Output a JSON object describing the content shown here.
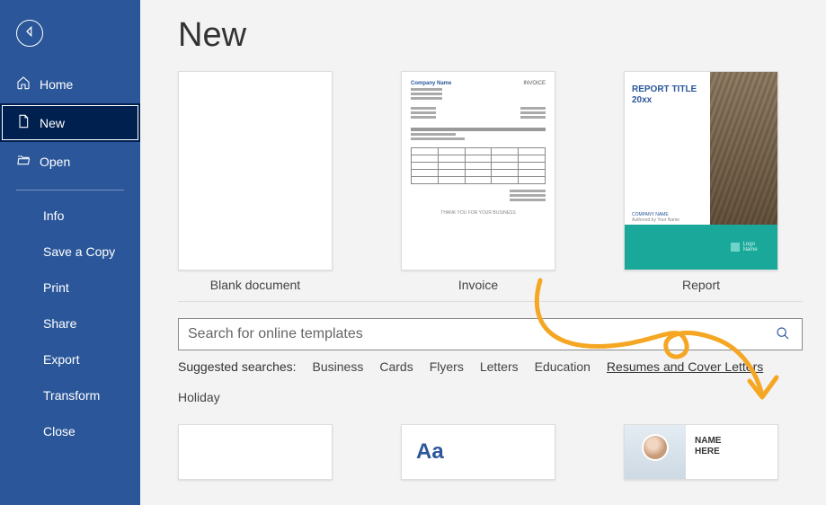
{
  "sidebar": {
    "nav": [
      {
        "label": "Home",
        "icon": "home"
      },
      {
        "label": "New",
        "icon": "file",
        "selected": true
      },
      {
        "label": "Open",
        "icon": "folder"
      }
    ],
    "sub": [
      "Info",
      "Save a Copy",
      "Print",
      "Share",
      "Export",
      "Transform",
      "Close"
    ]
  },
  "page": {
    "title": "New"
  },
  "templates": [
    {
      "label": "Blank document",
      "kind": "blank"
    },
    {
      "label": "Invoice",
      "kind": "invoice"
    },
    {
      "label": "Report",
      "kind": "report"
    }
  ],
  "search": {
    "placeholder": "Search for online templates"
  },
  "suggested": {
    "label": "Suggested searches:",
    "items": [
      {
        "text": "Business"
      },
      {
        "text": "Cards"
      },
      {
        "text": "Flyers"
      },
      {
        "text": "Letters"
      },
      {
        "text": "Education"
      },
      {
        "text": "Resumes and Cover Letters",
        "visited": true
      },
      {
        "text": "Holiday"
      }
    ]
  },
  "thumb_text": {
    "invoice_company": "Company Name",
    "invoice_word": "INVOICE",
    "invoice_footer": "THANK YOU FOR YOUR BUSINESS",
    "report_title": "REPORT TITLE",
    "report_year": "20xx",
    "report_company": "COMPANY NAME",
    "report_author": "Authored by Your Name",
    "report_logo": "Logo\nName",
    "aa": "Aa",
    "resume_name1": "NAME",
    "resume_name2": "HERE"
  }
}
